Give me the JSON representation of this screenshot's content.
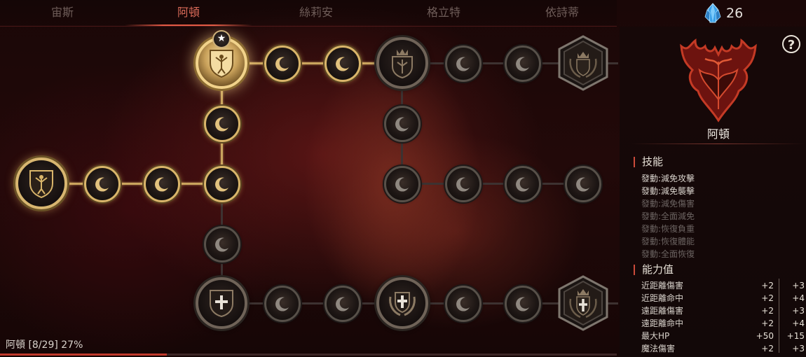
{
  "tabs": [
    {
      "label": "宙斯",
      "active": false
    },
    {
      "label": "阿頓",
      "active": true
    },
    {
      "label": "絲莉安",
      "active": false
    },
    {
      "label": "格立特",
      "active": false
    },
    {
      "label": "依詩蒂",
      "active": false
    }
  ],
  "currency": {
    "value": "26",
    "icon": "blue-crystal-icon"
  },
  "hero": {
    "name": "阿頓",
    "crest_icon": "red-demon-crest-icon"
  },
  "help": {
    "label": "?"
  },
  "skills": {
    "heading": "技能",
    "items": [
      {
        "label": "發動:減免攻擊",
        "unlocked": true
      },
      {
        "label": "發動:減免襲擊",
        "unlocked": true
      },
      {
        "label": "發動:減免傷害",
        "unlocked": false
      },
      {
        "label": "發動:全面減免",
        "unlocked": false
      },
      {
        "label": "發動:恢復負重",
        "unlocked": false
      },
      {
        "label": "發動:恢復體能",
        "unlocked": false
      },
      {
        "label": "發動:全面恢復",
        "unlocked": false
      }
    ]
  },
  "stats": {
    "heading": "能力值",
    "rows": [
      {
        "label": "近距離傷害",
        "v1": "+2",
        "v2": "+3"
      },
      {
        "label": "近距離命中",
        "v1": "+2",
        "v2": "+4"
      },
      {
        "label": "遠距離傷害",
        "v1": "+2",
        "v2": "+3"
      },
      {
        "label": "遠距離命中",
        "v1": "+2",
        "v2": "+4"
      },
      {
        "label": "最大HP",
        "v1": "+50",
        "v2": "+15"
      },
      {
        "label": "魔法傷害",
        "v1": "+2",
        "v2": "+3"
      }
    ]
  },
  "progress": {
    "text": "阿頓 [8/29] 27%",
    "current": 8,
    "total": 29,
    "percent": 27
  },
  "colors": {
    "accent": "#e35a45",
    "gold": "#d9b56a",
    "progress": "#c0392b"
  },
  "tree": {
    "star_badge": "★",
    "node_icons": [
      "crescent-moon-icon",
      "shield-figure-icon",
      "crown-shield-icon",
      "cross-shield-icon",
      "laurel-cross-icon"
    ]
  }
}
